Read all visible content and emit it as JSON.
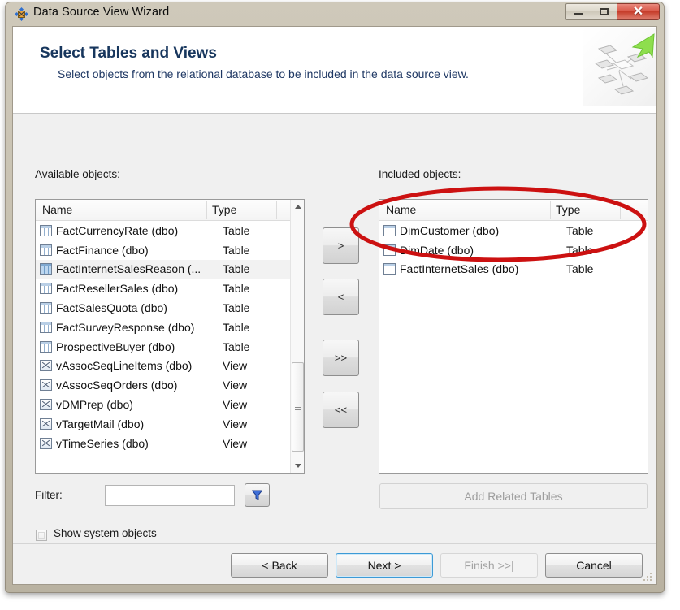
{
  "window": {
    "title": "Data Source View Wizard",
    "icon": "wizard-icon",
    "minimize_label": "Minimize",
    "maximize_label": "Maximize",
    "close_label": "Close"
  },
  "header": {
    "title": "Select Tables and Views",
    "subtitle": "Select objects from the relational database to be included in the data source view.",
    "art": "data-source-view-diagram-image"
  },
  "available": {
    "label": "Available objects:",
    "columns": [
      "Name",
      "Type"
    ],
    "rows": [
      {
        "name": "FactCurrencyRate (dbo)",
        "type": "Table",
        "icon": "table-icon",
        "selected": false
      },
      {
        "name": "FactFinance (dbo)",
        "type": "Table",
        "icon": "table-icon",
        "selected": false
      },
      {
        "name": "FactInternetSalesReason (...",
        "type": "Table",
        "icon": "table-icon",
        "selected": true
      },
      {
        "name": "FactResellerSales (dbo)",
        "type": "Table",
        "icon": "table-icon",
        "selected": false
      },
      {
        "name": "FactSalesQuota (dbo)",
        "type": "Table",
        "icon": "table-icon",
        "selected": false
      },
      {
        "name": "FactSurveyResponse (dbo)",
        "type": "Table",
        "icon": "table-icon",
        "selected": false
      },
      {
        "name": "ProspectiveBuyer (dbo)",
        "type": "Table",
        "icon": "table-icon",
        "selected": false
      },
      {
        "name": "vAssocSeqLineItems (dbo)",
        "type": "View",
        "icon": "view-icon",
        "selected": false
      },
      {
        "name": "vAssocSeqOrders (dbo)",
        "type": "View",
        "icon": "view-icon",
        "selected": false
      },
      {
        "name": "vDMPrep (dbo)",
        "type": "View",
        "icon": "view-icon",
        "selected": false
      },
      {
        "name": "vTargetMail (dbo)",
        "type": "View",
        "icon": "view-icon",
        "selected": false
      },
      {
        "name": "vTimeSeries (dbo)",
        "type": "View",
        "icon": "view-icon",
        "selected": false
      }
    ]
  },
  "included": {
    "label": "Included objects:",
    "columns": [
      "Name",
      "Type"
    ],
    "rows": [
      {
        "name": "DimCustomer (dbo)",
        "type": "Table",
        "icon": "table-icon"
      },
      {
        "name": "DimDate (dbo)",
        "type": "Table",
        "icon": "table-icon"
      },
      {
        "name": "FactInternetSales (dbo)",
        "type": "Table",
        "icon": "table-icon"
      }
    ]
  },
  "transfer": {
    "add_label": ">",
    "remove_label": "<",
    "add_all_label": ">>",
    "remove_all_label": "<<"
  },
  "filter": {
    "label": "Filter:",
    "value": "",
    "placeholder": "",
    "button_icon": "funnel-filter-icon"
  },
  "show_system_objects": {
    "label": "Show system objects",
    "checked": false
  },
  "add_related": {
    "label": "Add Related Tables",
    "enabled": false
  },
  "footer": {
    "back_label": "< Back",
    "next_label": "Next >",
    "finish_label": "Finish >>|",
    "cancel_label": "Cancel"
  },
  "annotation": {
    "shape": "red-ellipse-highlight",
    "color": "#cc1111"
  }
}
